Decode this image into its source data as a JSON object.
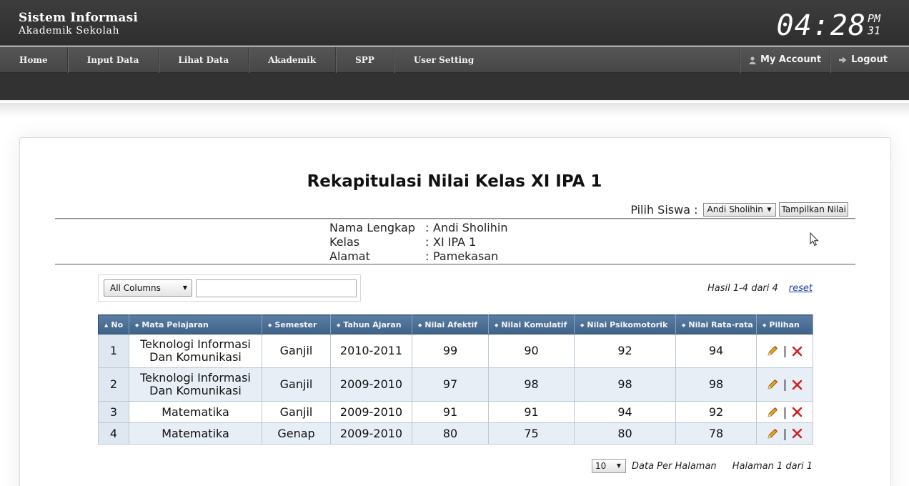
{
  "header": {
    "brand_line1": "Sistem Informasi",
    "brand_line2": "Akademik Sekolah",
    "clock_time": "04:28",
    "clock_ampm": "PM",
    "clock_sec": "31"
  },
  "nav": {
    "items": [
      "Home",
      "Input Data",
      "Lihat Data",
      "Akademik",
      "SPP",
      "User Setting"
    ],
    "my_account": "My Account",
    "logout": "Logout"
  },
  "page": {
    "title": "Rekapitulasi Nilai Kelas XI IPA 1",
    "pilih_label": "Pilih Siswa :",
    "siswa_selected": "Andi Sholihin",
    "tampilkan_button": "Tampilkan Nilai"
  },
  "student": {
    "rows": [
      {
        "key": "Nama Lengkap",
        "sep": ":",
        "value": "Andi Sholihin"
      },
      {
        "key": "Kelas",
        "sep": ":",
        "value": "XI IPA 1"
      },
      {
        "key": "Alamat",
        "sep": ":",
        "value": "Pamekasan"
      }
    ]
  },
  "filter": {
    "column_selected": "All Columns",
    "search_value": "",
    "hasil": "Hasil 1-4 dari 4",
    "reset": "reset"
  },
  "table": {
    "headers": [
      "No",
      "Mata Pelajaran",
      "Semester",
      "Tahun Ajaran",
      "Nilai Afektif",
      "Nilai Komulatif",
      "Nilai Psikomotorik",
      "Nilai Rata-rata",
      "Pilihan"
    ],
    "rows": [
      {
        "no": "1",
        "mapel": "Teknologi Informasi Dan Komunikasi",
        "semester": "Ganjil",
        "tahun": "2010-2011",
        "afektif": "99",
        "komulatif": "90",
        "psikomotorik": "92",
        "rata": "94"
      },
      {
        "no": "2",
        "mapel": "Teknologi Informasi Dan Komunikasi",
        "semester": "Ganjil",
        "tahun": "2009-2010",
        "afektif": "97",
        "komulatif": "98",
        "psikomotorik": "98",
        "rata": "98"
      },
      {
        "no": "3",
        "mapel": "Matematika",
        "semester": "Ganjil",
        "tahun": "2009-2010",
        "afektif": "91",
        "komulatif": "91",
        "psikomotorik": "94",
        "rata": "92"
      },
      {
        "no": "4",
        "mapel": "Matematika",
        "semester": "Genap",
        "tahun": "2009-2010",
        "afektif": "80",
        "komulatif": "75",
        "psikomotorik": "80",
        "rata": "78"
      }
    ],
    "action_separator": "|"
  },
  "pager": {
    "per_page": "10",
    "per_page_label": "Data Per Halaman",
    "page_info": "Halaman 1 dari 1"
  },
  "colors": {
    "header_bg": "#333333",
    "table_header": "#4a6d94",
    "row_alt": "#e7eef5",
    "delete_red": "#d11a1a",
    "link_blue": "#1a3ea8"
  }
}
